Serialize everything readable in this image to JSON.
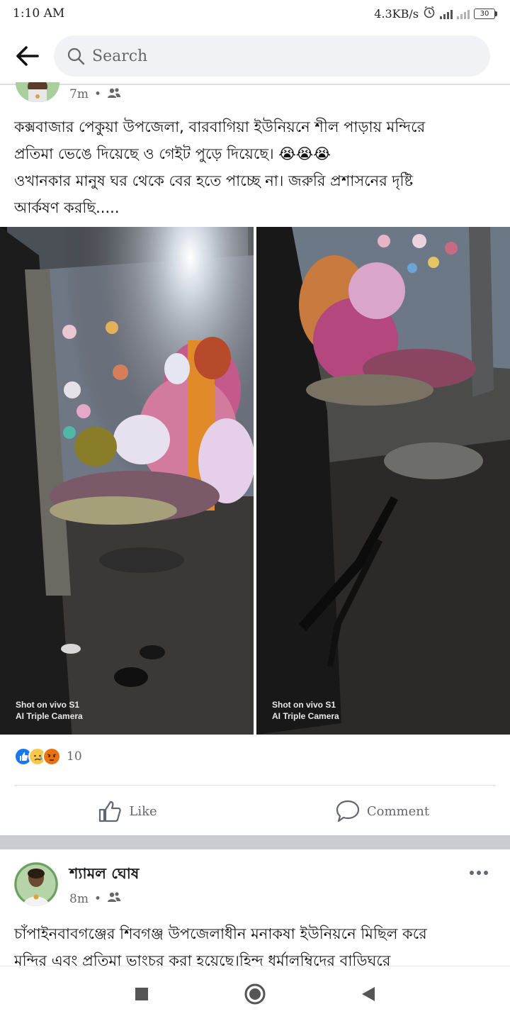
{
  "status_bar": {
    "time": "1:10 AM",
    "speed": "4.3KB/s",
    "battery": "30"
  },
  "header": {
    "search_placeholder": "Search"
  },
  "post1": {
    "time": "7m",
    "text_lines": [
      "কক্সবাজার পেকুয়া উপজেলা, বারবাগিয়া ইউনিয়নে শীল পাড়ায় মন্দিরে",
      "প্রতিমা ভেঙে দিয়েছে ও গেইট পুড়ে দিয়েছে। 😭😭😭",
      "ওখানকার মানুষ ঘর থেকে বের হতে পাচ্ছে না। জরুরি প্রশাসনের দৃষ্টি",
      "আর্কষণ করছি....."
    ],
    "photo_watermark_line1": "Shot on vivo S1",
    "photo_watermark_line2": "AI Triple Camera",
    "reaction_count": "10",
    "like_label": "Like",
    "comment_label": "Comment"
  },
  "post2": {
    "author": "শ্যামল ঘোষ",
    "time": "8m",
    "text_lines": [
      "চাঁপাইনবাবগঞ্জের শিবগঞ্জ উপজেলাধীন মনাকষা ইউনিয়নে মিছিল করে",
      "মন্দির এবং প্রতিমা ভাংচুর করা হয়েছে।হিন্দু ধর্মালম্বিদের বাড়িঘরে"
    ]
  },
  "colors": {
    "accent": "#1877f2",
    "secondary_text": "#65676b",
    "separator": "#c9ccd1"
  }
}
